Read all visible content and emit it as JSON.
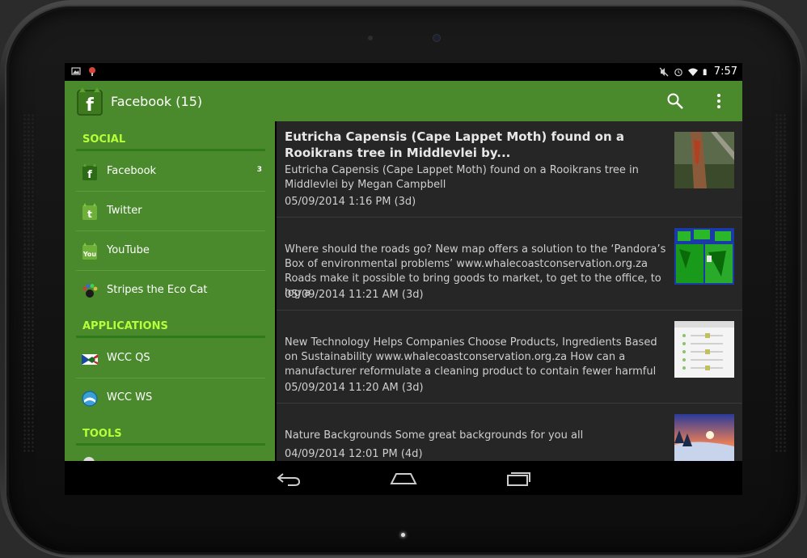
{
  "status_bar": {
    "left_icons": [
      "image-icon",
      "notification-app-icon"
    ],
    "right_icons": [
      "mute-icon",
      "alarm-icon",
      "wifi-icon",
      "battery-icon"
    ],
    "time": "7:57"
  },
  "action_bar": {
    "title": "Facebook (15)",
    "icons": [
      "search-icon",
      "overflow-menu-icon"
    ]
  },
  "drawer": {
    "sections": [
      {
        "title": "SOCIAL"
      },
      {
        "title": "APPLICATIONS"
      },
      {
        "title": "TOOLS"
      }
    ],
    "items": [
      {
        "label": "Facebook",
        "count": "3",
        "icon": "facebook-icon"
      },
      {
        "label": "Twitter",
        "count": "",
        "icon": "twitter-icon"
      },
      {
        "label": "YouTube",
        "count": "",
        "icon": "youtube-icon"
      },
      {
        "label": "Stripes the Eco Cat",
        "count": "",
        "icon": "paw-icon"
      },
      {
        "label": "WCC QS",
        "count": "",
        "icon": "wcc-qs-icon"
      },
      {
        "label": "WCC WS",
        "count": "",
        "icon": "wcc-ws-icon"
      }
    ]
  },
  "feed": [
    {
      "title": "Eutricha Capensis (Cape Lappet Moth) found on a Rooikrans tree in Middlevlei by...",
      "text": "Eutricha Capensis (Cape Lappet Moth) found on a Rooikrans tree in Middlevlei by Megan Campbell",
      "date": "05/09/2014 1:16 PM (3d)"
    },
    {
      "title": "",
      "text": "Where should the roads go? New map offers a solution to the ‘Pandora’s Box of environmental problems’ www.whalecoastconservation.org.za Roads make it possible to bring goods to market, to get to the office, to log a",
      "date": "05/09/2014 11:21 AM (3d)"
    },
    {
      "title": "",
      "text": "New Technology Helps Companies Choose Products, Ingredients Based on Sustainability www.whalecoastconservation.org.za How can a manufacturer reformulate a cleaning product to contain fewer harmful",
      "date": "05/09/2014 11:20 AM (3d)"
    },
    {
      "title": "",
      "text": "Nature Backgrounds Some great backgrounds for you all",
      "date": "04/09/2014 12:01 PM (4d)"
    }
  ],
  "nav_bar": {
    "icons": [
      "back-icon",
      "home-icon",
      "recents-icon"
    ]
  },
  "colors": {
    "accent": "#4a8a2c",
    "section_title": "#b6ff3a",
    "list_background": "#262626"
  }
}
